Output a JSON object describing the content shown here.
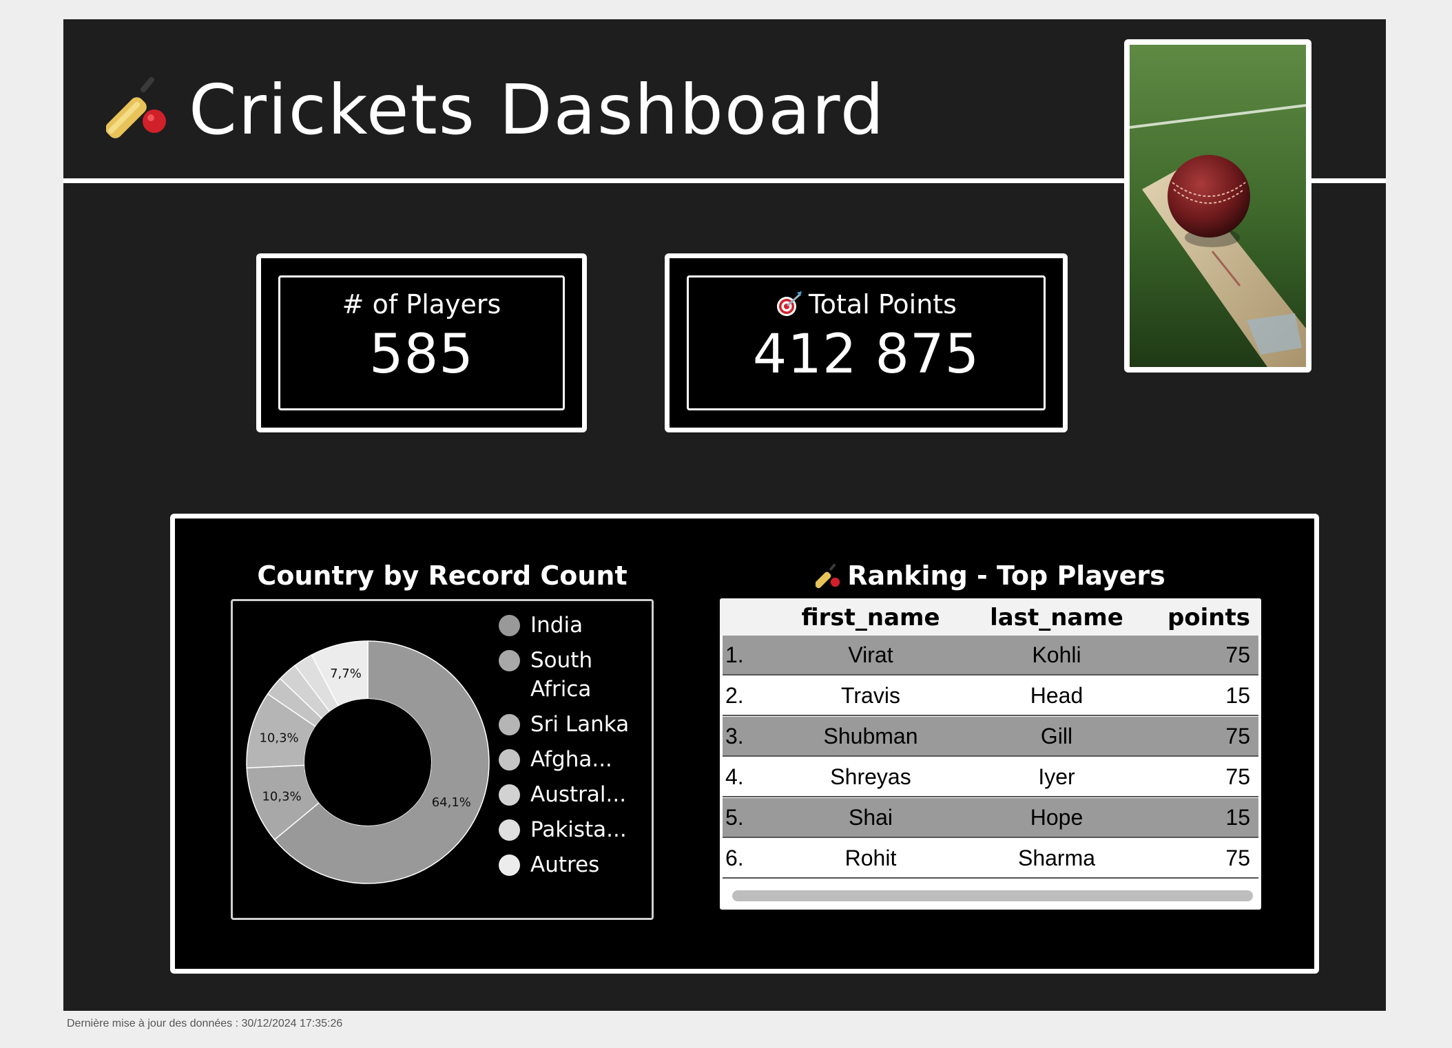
{
  "header": {
    "title": "Crickets Dashboard",
    "title_icon": "cricket-bat-icon",
    "photo": "cricket-ball-on-bat-photo"
  },
  "kpis": {
    "players_label": "# of Players",
    "players_value": "585",
    "points_label": "Total Points",
    "points_icon": "target-icon",
    "points_value": "412 875"
  },
  "chart_section": {
    "title": "Country by Record Count",
    "legend": [
      {
        "label": "India",
        "color": "#999999"
      },
      {
        "label": "South Africa",
        "color": "#a8a8a8"
      },
      {
        "label": "Sri Lanka",
        "color": "#b5b5b5"
      },
      {
        "label": "Afgha...",
        "color": "#c4c4c4"
      },
      {
        "label": "Austral...",
        "color": "#d2d2d2"
      },
      {
        "label": "Pakista...",
        "color": "#dfdfdf"
      },
      {
        "label": "Autres",
        "color": "#ececec"
      }
    ]
  },
  "chart_data": {
    "type": "pie",
    "title": "Country by Record Count",
    "categories": [
      "India",
      "South Africa",
      "Sri Lanka",
      "Afgha...",
      "Austral...",
      "Pakista...",
      "Autres"
    ],
    "values": [
      64.1,
      10.3,
      10.3,
      2.6,
      2.6,
      2.6,
      7.7
    ],
    "labels": [
      "64,1%",
      "10,3%",
      "10,3%",
      "",
      "",
      "",
      "7,7%"
    ],
    "colors": [
      "#999999",
      "#a8a8a8",
      "#b5b5b5",
      "#c4c4c4",
      "#d2d2d2",
      "#dfdfdf",
      "#ececec"
    ],
    "donut": true,
    "legend": "right"
  },
  "ranking": {
    "title": "Ranking - Top Players",
    "title_icon": "cricket-bat-icon",
    "columns": [
      "first_name",
      "last_name",
      "points"
    ],
    "rows": [
      {
        "idx": "1.",
        "first": "Virat",
        "last": "Kohli",
        "points": "75"
      },
      {
        "idx": "2.",
        "first": "Travis",
        "last": "Head",
        "points": "15"
      },
      {
        "idx": "3.",
        "first": "Shubman",
        "last": "Gill",
        "points": "75"
      },
      {
        "idx": "4.",
        "first": "Shreyas",
        "last": "Iyer",
        "points": "75"
      },
      {
        "idx": "5.",
        "first": "Shai",
        "last": "Hope",
        "points": "15"
      },
      {
        "idx": "6.",
        "first": "Rohit",
        "last": "Sharma",
        "points": "75"
      }
    ]
  },
  "footer": {
    "last_update": "Dernière mise à jour des données : 30/12/2024 17:35:26"
  }
}
